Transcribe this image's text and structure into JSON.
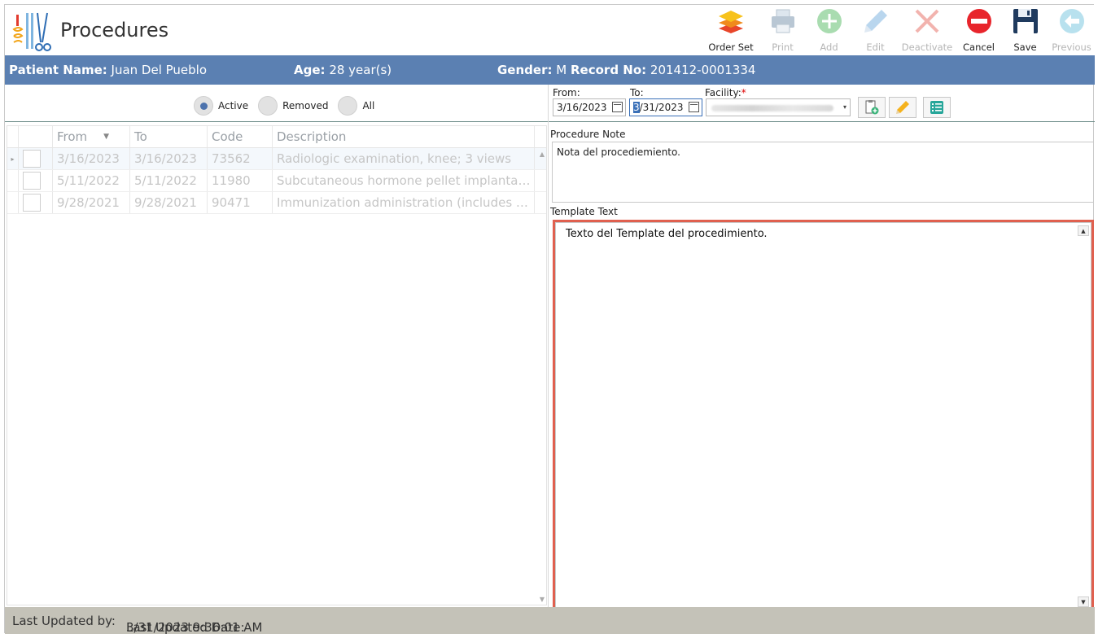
{
  "window": {
    "title": "Procedures"
  },
  "toolbar": {
    "buttons": [
      {
        "label": "Order Set",
        "icon": "layers-icon",
        "enabled": true
      },
      {
        "label": "Print",
        "icon": "printer-icon",
        "enabled": false
      },
      {
        "label": "Add",
        "icon": "plus-icon",
        "enabled": false
      },
      {
        "label": "Edit",
        "icon": "pencil-icon",
        "enabled": false
      },
      {
        "label": "Deactivate",
        "icon": "x-icon",
        "enabled": false
      },
      {
        "label": "Cancel",
        "icon": "cancel-icon",
        "enabled": true
      },
      {
        "label": "Save",
        "icon": "floppy-icon",
        "enabled": true
      },
      {
        "label": "Previous",
        "icon": "arrow-left-icon",
        "enabled": false
      }
    ]
  },
  "patient": {
    "name_label": "Patient Name:",
    "name": "Juan Del Pueblo",
    "age_label": "Age:",
    "age": "28 year(s)",
    "gender_label": "Gender:",
    "gender": "M",
    "record_label": "Record No:",
    "record": "201412-0001334"
  },
  "filter": {
    "options": [
      "Active",
      "Removed",
      "All"
    ],
    "selected": "Active"
  },
  "grid": {
    "columns": [
      "From",
      "To",
      "Code",
      "Description"
    ],
    "rows": [
      {
        "from": "3/16/2023",
        "to": "3/16/2023",
        "code": "73562",
        "description": "Radiologic examination, knee; 3 views"
      },
      {
        "from": "5/11/2022",
        "to": "5/11/2022",
        "code": "11980",
        "description": "Subcutaneous hormone pellet implantatio..."
      },
      {
        "from": "9/28/2021",
        "to": "9/28/2021",
        "code": "90471",
        "description": "Immunization administration (includes per..."
      }
    ]
  },
  "dates": {
    "from_label": "From:",
    "from_value": "3/16/2023",
    "to_label": "To:",
    "to_caret": "3",
    "to_rest": "/31/2023",
    "facility_label": "Facility:",
    "required_mark": "*"
  },
  "procedure_note": {
    "label": "Procedure Note",
    "text": "Nota del procediemiento."
  },
  "template": {
    "label": "Template Text",
    "text": "Texto del Template del procedimiento."
  },
  "footer": {
    "updated_by_label": "Last Updated by:",
    "updated_date_label": "Last Updated Date:",
    "updated_date": "3/31/2023 9:36:01 AM"
  },
  "colors": {
    "patient_bar": "#5b80b2",
    "footer": "#c4c2b8",
    "highlight": "#e0604f"
  }
}
